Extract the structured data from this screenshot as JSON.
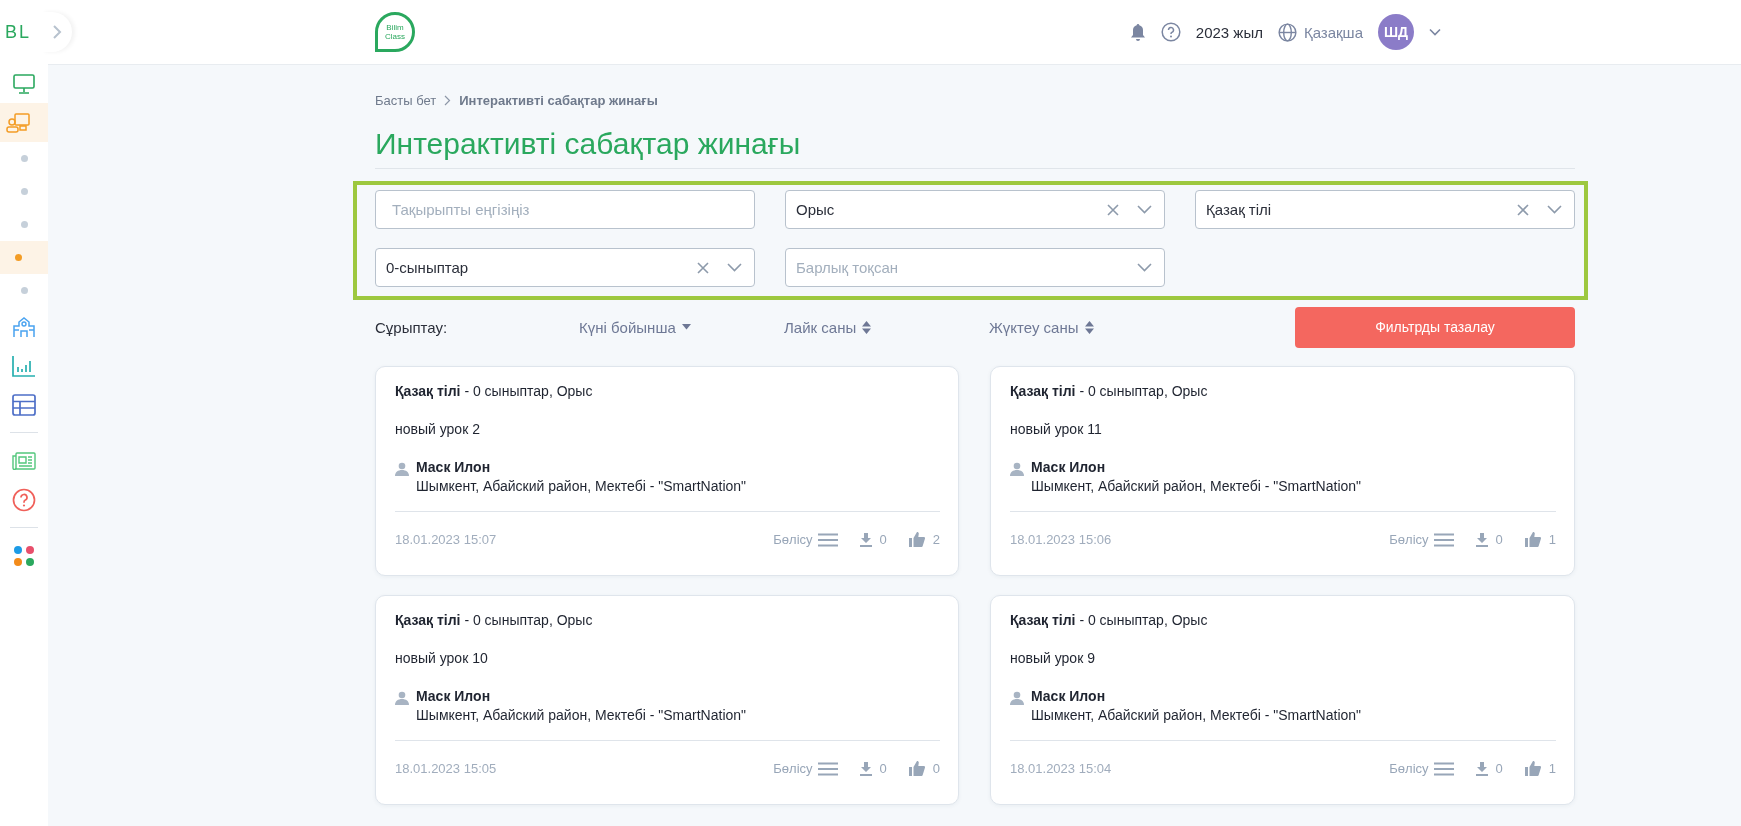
{
  "sidebar": {
    "logo": "BL",
    "groups": [
      [
        {
          "kind": "monitor",
          "selected": false
        },
        {
          "kind": "classroom",
          "selected": true
        },
        {
          "kind": "dot",
          "selected": false
        },
        {
          "kind": "dot",
          "selected": false
        },
        {
          "kind": "dot",
          "selected": false
        },
        {
          "kind": "dot",
          "selected": true
        },
        {
          "kind": "dot",
          "selected": false
        },
        {
          "kind": "school",
          "selected": false
        },
        {
          "kind": "chart",
          "selected": false
        },
        {
          "kind": "table",
          "selected": false
        }
      ],
      [
        {
          "kind": "news",
          "selected": false
        },
        {
          "kind": "help",
          "selected": false
        }
      ],
      [
        {
          "kind": "apps",
          "selected": false
        }
      ]
    ]
  },
  "header": {
    "logo": [
      "Bilim",
      "Class"
    ],
    "year": "2023 жыл",
    "language": "Қазақша",
    "avatar": "ШД"
  },
  "breadcrumb": [
    {
      "label": "Басты бет",
      "current": false
    },
    {
      "label": "Интерактивті сабақтар жинағы",
      "current": true
    }
  ],
  "page_title": "Интерактивті сабақтар жинағы",
  "filters": [
    {
      "kind": "text",
      "placeholder": "Тақырыпты еңгізіңіз"
    },
    {
      "kind": "select",
      "value": "Орыс"
    },
    {
      "kind": "select",
      "value": "Қазақ тілі"
    },
    {
      "kind": "select",
      "value": "0-сыныптар"
    },
    {
      "kind": "select",
      "placeholder": "Барлық тоқсан"
    }
  ],
  "sort": {
    "label": "Сұрыптау:",
    "options": [
      {
        "label": "Күні бойынша",
        "sorted": true
      },
      {
        "label": "Лайк саны",
        "sorted": false
      },
      {
        "label": "Жүктеу саны",
        "sorted": false
      }
    ],
    "clear_button": "Фильтрды тазалау"
  },
  "cards": [
    {
      "subject": "Қазақ тілі",
      "details": " - 0 сыныптар, Орыс",
      "title": "новый урок 2",
      "author": "Маск Илон",
      "school": "Шымкент, Абайский район, Мектебі - \"SmartNation\"",
      "date": "18.01.2023 15:07",
      "share": "Бөлісу",
      "downloads": "0",
      "likes": "2"
    },
    {
      "subject": "Қазақ тілі",
      "details": " - 0 сыныптар, Орыс",
      "title": "новый урок 11",
      "author": "Маск Илон",
      "school": "Шымкент, Абайский район, Мектебі - \"SmartNation\"",
      "date": "18.01.2023 15:06",
      "share": "Бөлісу",
      "downloads": "0",
      "likes": "1"
    },
    {
      "subject": "Қазақ тілі",
      "details": " - 0 сыныптар, Орыс",
      "title": "новый урок 10",
      "author": "Маск Илон",
      "school": "Шымкент, Абайский район, Мектебі - \"SmartNation\"",
      "date": "18.01.2023 15:05",
      "share": "Бөлісу",
      "downloads": "0",
      "likes": "0"
    },
    {
      "subject": "Қазақ тілі",
      "details": " - 0 сыныптар, Орыс",
      "title": "новый урок 9",
      "author": "Маск Илон",
      "school": "Шымкент, Абайский район, Мектебі - \"SmartNation\"",
      "date": "18.01.2023 15:04",
      "share": "Бөлісу",
      "downloads": "0",
      "likes": "1"
    }
  ]
}
